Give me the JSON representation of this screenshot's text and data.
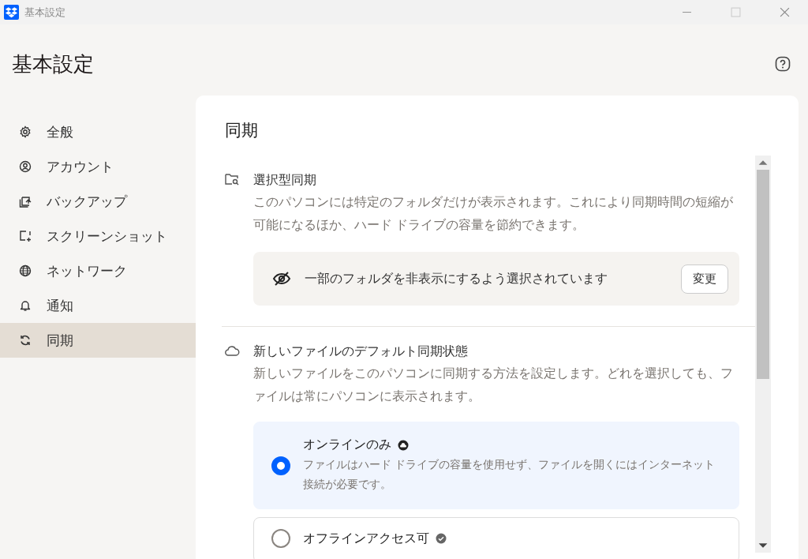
{
  "window": {
    "title": "基本設定"
  },
  "header": {
    "title": "基本設定"
  },
  "sidebar": {
    "items": [
      {
        "label": "全般",
        "selected": false
      },
      {
        "label": "アカウント",
        "selected": false
      },
      {
        "label": "バックアップ",
        "selected": false
      },
      {
        "label": "スクリーンショット",
        "selected": false
      },
      {
        "label": "ネットワーク",
        "selected": false
      },
      {
        "label": "通知",
        "selected": false
      },
      {
        "label": "同期",
        "selected": true
      }
    ]
  },
  "panel": {
    "title": "同期",
    "selective_sync": {
      "title": "選択型同期",
      "description": "このパソコンには特定のフォルダだけが表示されます。これにより同期時間の短縮が可能になるほか、ハード ドライブの容量を節約できます。",
      "status": "一部のフォルダを非表示にするよう選択されています",
      "button": "変更"
    },
    "default_state": {
      "title": "新しいファイルのデフォルト同期状態",
      "description": "新しいファイルをこのパソコンに同期する方法を設定します。どれを選択しても、ファイルは常にパソコンに表示されます。",
      "options": [
        {
          "label": "オンラインのみ",
          "description": "ファイルはハード ドライブの容量を使用せず、ファイルを開くにはインターネット接続が必要です。",
          "selected": true
        },
        {
          "label": "オフラインアクセス可",
          "selected": false
        }
      ]
    }
  }
}
